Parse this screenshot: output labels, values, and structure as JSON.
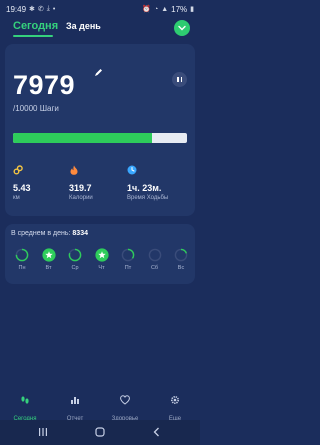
{
  "status_bar": {
    "time": "19:49",
    "battery": "17%"
  },
  "tabs": {
    "today": "Сегодня",
    "day": "За день"
  },
  "steps": {
    "count": "7979",
    "goal": "/10000 Шаги",
    "progress_fraction": 0.798
  },
  "metrics": [
    {
      "value": "5.43",
      "label": "км",
      "icon": "location-icon",
      "color": "#f4c542"
    },
    {
      "value": "319.7",
      "label": "Калории",
      "icon": "flame-icon",
      "color": "#ff8a3d"
    },
    {
      "value": "1ч. 23м.",
      "label": "Время Ходьбы",
      "icon": "clock-icon",
      "color": "#39a7ff"
    }
  ],
  "week": {
    "average_label": "В среднем в день:",
    "average_value": "8334",
    "days": [
      {
        "label": "Пн",
        "fraction": 0.75,
        "done": false
      },
      {
        "label": "Вт",
        "fraction": 1.0,
        "done": true
      },
      {
        "label": "Ср",
        "fraction": 0.8,
        "done": false
      },
      {
        "label": "Чт",
        "fraction": 1.0,
        "done": true
      },
      {
        "label": "Пт",
        "fraction": 0.35,
        "done": false
      },
      {
        "label": "Сб",
        "fraction": 0.0,
        "done": false
      },
      {
        "label": "Вс",
        "fraction": 0.2,
        "done": false
      }
    ]
  },
  "nav": {
    "items": [
      {
        "label": "Сегодня",
        "icon": "footsteps-icon",
        "active": true
      },
      {
        "label": "Отчет",
        "icon": "bar-chart-icon",
        "active": false
      },
      {
        "label": "Здоровье",
        "icon": "heart-icon",
        "active": false
      },
      {
        "label": "Еще",
        "icon": "gear-icon",
        "active": false
      }
    ]
  },
  "colors": {
    "accent": "#35d17d",
    "background": "#1b2d5c",
    "card": "#223768",
    "progress": "#2ecc5b"
  }
}
